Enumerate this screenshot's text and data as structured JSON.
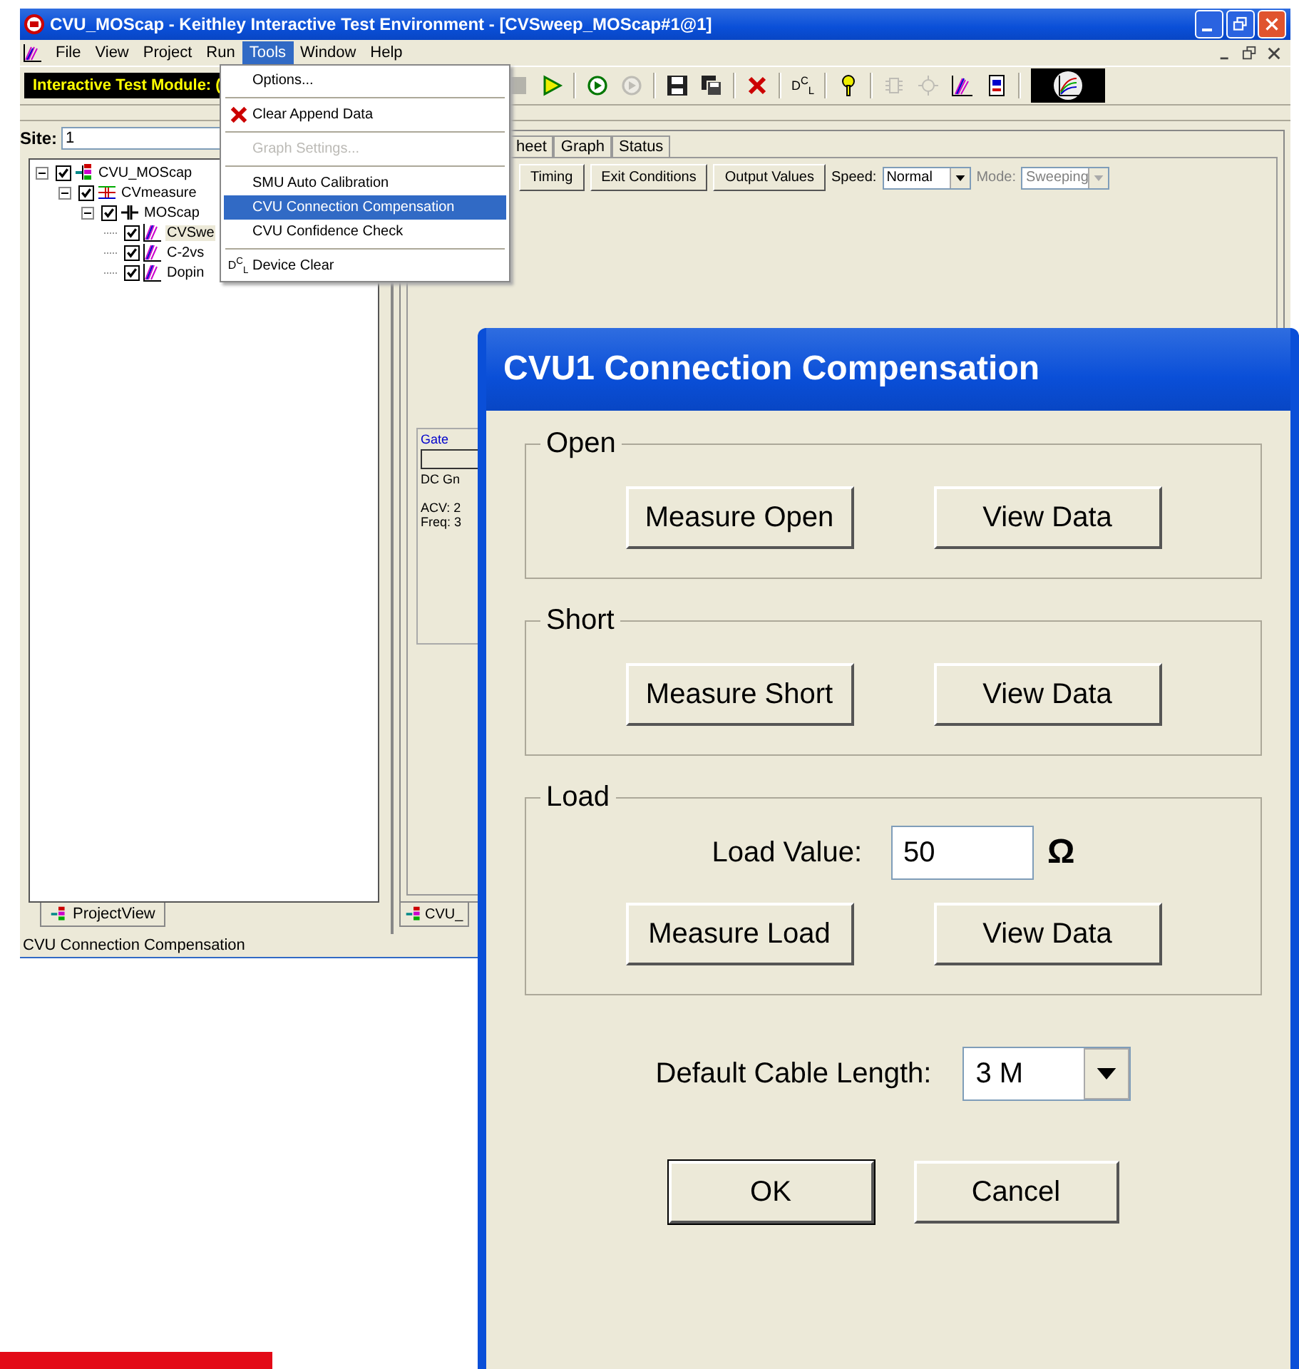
{
  "window": {
    "title": "CVU_MOScap - Keithley Interactive Test Environment - [CVSweep_MOScap#1@1]"
  },
  "menu_bar": [
    {
      "label": "File",
      "selected": false
    },
    {
      "label": "View",
      "selected": false
    },
    {
      "label": "Project",
      "selected": false
    },
    {
      "label": "Run",
      "selected": false
    },
    {
      "label": "Tools",
      "selected": true
    },
    {
      "label": "Window",
      "selected": false
    },
    {
      "label": "Help",
      "selected": false
    }
  ],
  "tools_menu": [
    {
      "kind": "item",
      "label": "Options...",
      "selected": false,
      "disabled": false
    },
    {
      "kind": "separator"
    },
    {
      "kind": "delete-item",
      "label": "Clear Append Data",
      "selected": false,
      "disabled": false
    },
    {
      "kind": "separator"
    },
    {
      "kind": "item",
      "label": "Graph Settings...",
      "selected": false,
      "disabled": true
    },
    {
      "kind": "separator"
    },
    {
      "kind": "item",
      "label": "SMU Auto Calibration",
      "selected": false,
      "disabled": false
    },
    {
      "kind": "item",
      "label": "CVU Connection Compensation",
      "selected": true,
      "disabled": false
    },
    {
      "kind": "item",
      "label": "CVU Confidence Check",
      "selected": false,
      "disabled": false
    },
    {
      "kind": "separator"
    },
    {
      "kind": "text-item",
      "label": "Device Clear",
      "icon_text": "D$^{C}$$_{L}$",
      "selected": false,
      "disabled": false
    }
  ],
  "toolbar": {
    "module_label": "Interactive Test Module: (",
    "buttons": [
      {
        "kind": "stop",
        "disabled": true
      },
      {
        "kind": "play",
        "disabled": false
      },
      {
        "kind": "separator"
      },
      {
        "kind": "run",
        "disabled": false
      },
      {
        "kind": "run-all",
        "disabled": true
      },
      {
        "kind": "separator"
      },
      {
        "kind": "save",
        "disabled": false
      },
      {
        "kind": "save-all",
        "disabled": false
      },
      {
        "kind": "separator"
      },
      {
        "kind": "delete",
        "disabled": false
      },
      {
        "kind": "separator"
      },
      {
        "kind": "text",
        "text": "D$^{C}$$_{L}$",
        "disabled": false
      },
      {
        "kind": "separator"
      },
      {
        "kind": "help",
        "disabled": false
      },
      {
        "kind": "separator"
      },
      {
        "kind": "chip",
        "disabled": true
      },
      {
        "kind": "sun",
        "disabled": true
      },
      {
        "kind": "graph",
        "disabled": false
      },
      {
        "kind": "sheet",
        "disabled": false
      },
      {
        "kind": "separator"
      },
      {
        "kind": "plot",
        "disabled": false
      }
    ]
  },
  "site": {
    "label": "Site:",
    "value": "1"
  },
  "tree": [
    {
      "label": "CVU_MOScap",
      "kind": "project",
      "checked": true,
      "expanded": true,
      "selected": false,
      "children": [
        {
          "label": "CVmeasure",
          "kind": "subsite",
          "checked": true,
          "expanded": true,
          "selected": false,
          "children": [
            {
              "label": "MOScap",
              "kind": "device",
              "checked": true,
              "expanded": true,
              "selected": false,
              "children": [
                {
                  "label": "CVSwe",
                  "kind": "test",
                  "checked": true,
                  "selected": true
                },
                {
                  "label": "C-2vs",
                  "kind": "test",
                  "checked": true,
                  "selected": false
                },
                {
                  "label": "Dopin",
                  "kind": "test",
                  "checked": true,
                  "selected": false
                }
              ]
            }
          ]
        }
      ]
    }
  ],
  "left_tab": "ProjectView",
  "editor": {
    "tabs": [
      "heet",
      "Graph",
      "Status"
    ],
    "buttons": [
      "Timing",
      "Exit Conditions",
      "Output Values"
    ],
    "speed": {
      "label": "Speed:",
      "value": "Normal"
    },
    "mode": {
      "label": "Mode:",
      "value": "Sweeping",
      "disabled": true
    },
    "gate": {
      "title": "Gate",
      "lines": [
        "DC Gn",
        "ACV: 2",
        "Freq: 3"
      ]
    },
    "bottom_tab": "CVU_"
  },
  "status_bar": "CVU Connection Compensation",
  "dialog": {
    "title": "CVU1 Connection Compensation",
    "groups": [
      {
        "title": "Open",
        "buttons": [
          "Measure Open",
          "View Data"
        ]
      },
      {
        "title": "Short",
        "buttons": [
          "Measure Short",
          "View Data"
        ]
      },
      {
        "title": "Load",
        "load_label": "Load Value:",
        "load_value": "50",
        "unit": "Ω",
        "buttons": [
          "Measure Load",
          "View Data"
        ]
      }
    ],
    "cable": {
      "label": "Default Cable Length:",
      "value": "3 M"
    },
    "buttons": [
      "OK",
      "Cancel"
    ]
  }
}
